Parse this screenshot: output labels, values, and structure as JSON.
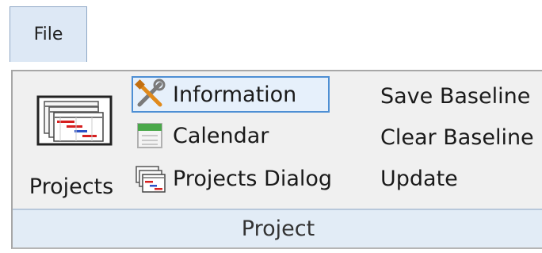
{
  "file_tab": {
    "label": "File"
  },
  "ribbon": {
    "group_label": "Project",
    "projects_button": {
      "label": "Projects",
      "icon": "gantt-chart-icon"
    },
    "small_buttons": [
      {
        "label": "Information",
        "icon": "tools-icon",
        "selected": true
      },
      {
        "label": "Calendar",
        "icon": "calendar-icon",
        "selected": false
      },
      {
        "label": "Projects Dialog",
        "icon": "gantt-chart-icon",
        "selected": false
      }
    ],
    "baseline_buttons": [
      {
        "label": "Save Baseline"
      },
      {
        "label": "Clear Baseline"
      },
      {
        "label": "Update"
      }
    ]
  }
}
